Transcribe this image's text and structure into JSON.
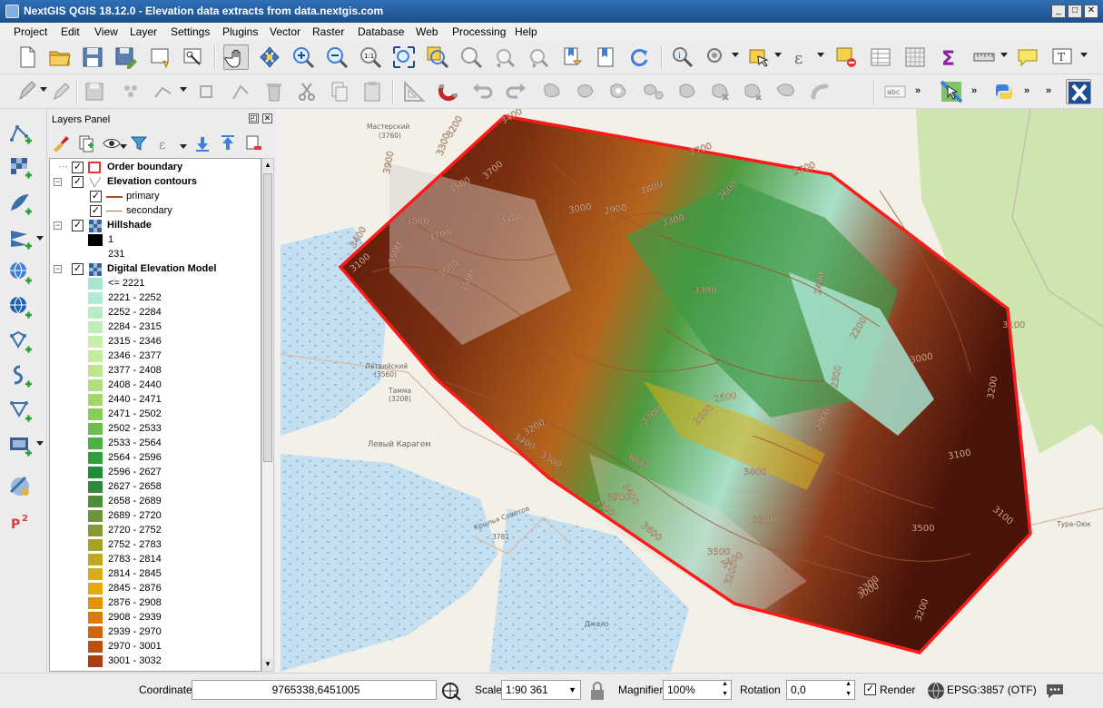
{
  "window": {
    "title": "NextGIS QGIS 18.12.0 - Elevation data extracts from data.nextgis.com",
    "minimize": "_",
    "maximize": "□",
    "close": "✕"
  },
  "menu": [
    "Project",
    "Edit",
    "View",
    "Layer",
    "Settings",
    "Plugins",
    "Vector",
    "Raster",
    "Database",
    "Web",
    "Processing",
    "Help"
  ],
  "layers_panel": {
    "title": "Layers Panel",
    "layers": [
      {
        "name": "Order boundary",
        "checked": true,
        "bold": true
      },
      {
        "name": "Elevation contours",
        "checked": true,
        "bold": true,
        "children": [
          "primary",
          "secondary"
        ]
      },
      {
        "name": "Hillshade",
        "checked": true,
        "bold": true,
        "legend": [
          "1",
          "231"
        ]
      },
      {
        "name": "Digital Elevation Model",
        "checked": true,
        "bold": true
      }
    ],
    "dem_legend": [
      {
        "label": "<= 2221",
        "color": "#a8e6d4"
      },
      {
        "label": "2221 - 2252",
        "color": "#b2ead2"
      },
      {
        "label": "2252 - 2284",
        "color": "#b9ecc5"
      },
      {
        "label": "2284 - 2315",
        "color": "#c0eeb8"
      },
      {
        "label": "2315 - 2346",
        "color": "#c6efa9"
      },
      {
        "label": "2346 - 2377",
        "color": "#c4ec9a"
      },
      {
        "label": "2377 - 2408",
        "color": "#bde68b"
      },
      {
        "label": "2408 - 2440",
        "color": "#b3df7b"
      },
      {
        "label": "2440 - 2471",
        "color": "#a4d76a"
      },
      {
        "label": "2471 - 2502",
        "color": "#8ccd5a"
      },
      {
        "label": "2502 - 2533",
        "color": "#6bbf4c"
      },
      {
        "label": "2533 - 2564",
        "color": "#4cb143"
      },
      {
        "label": "2564 - 2596",
        "color": "#2f9f3c"
      },
      {
        "label": "2596 - 2627",
        "color": "#1f8c38"
      },
      {
        "label": "2627 - 2658",
        "color": "#2e8a3a"
      },
      {
        "label": "2658 - 2689",
        "color": "#4a8d3a"
      },
      {
        "label": "2689 - 2720",
        "color": "#6a9436"
      },
      {
        "label": "2720 - 2752",
        "color": "#8a9a30"
      },
      {
        "label": "2752 - 2783",
        "color": "#a6a228"
      },
      {
        "label": "2783 - 2814",
        "color": "#c0a81e"
      },
      {
        "label": "2814 - 2845",
        "color": "#d8ad12"
      },
      {
        "label": "2845 - 2876",
        "color": "#e8a808"
      },
      {
        "label": "2876 - 2908",
        "color": "#e69104"
      },
      {
        "label": "2908 - 2939",
        "color": "#dd7a05"
      },
      {
        "label": "2939 - 2970",
        "color": "#cf6408"
      },
      {
        "label": "2970 - 3001",
        "color": "#bf500b"
      },
      {
        "label": "3001 - 3032",
        "color": "#ab3e0d"
      }
    ]
  },
  "map": {
    "contour_labels": [
      "3400",
      "3200",
      "3900",
      "3700",
      "3300",
      "3500",
      "2700",
      "2700",
      "2600",
      "2800",
      "2900",
      "3000",
      "3400",
      "3300",
      "3800",
      "3700",
      "3400",
      "3100",
      "3500",
      "3600",
      "3500",
      "2400",
      "3300",
      "2300",
      "2200",
      "2300",
      "3100",
      "3000",
      "3200",
      "2500",
      "2600",
      "2700",
      "3400",
      "3200",
      "3300",
      "3000",
      "3100",
      "3400",
      "3100",
      "3500",
      "3300",
      "3300",
      "3400",
      "3500",
      "3600",
      "3500",
      "3400",
      "3200",
      "3300",
      "3200",
      "3000"
    ],
    "place_labels": [
      "Мастерский",
      "(3760)",
      "Латвийский",
      "(3560)",
      "Тамма",
      "(3208)",
      "Левый Карагем",
      "Крылья Советов",
      "3781",
      "Джело",
      "Тура-Оюк"
    ],
    "colors": {
      "boundary": "#ff1a1a",
      "water": "#c4dff0",
      "forest": "#cfe5b0",
      "contour": "#a0522d"
    }
  },
  "status": {
    "coordinate_label": "Coordinate",
    "coordinate_value": "9765338,6451005",
    "scale_label": "Scale",
    "scale_value": "1:90 361",
    "magnifier_label": "Magnifier",
    "magnifier_value": "100%",
    "rotation_label": "Rotation",
    "rotation_value": "0,0",
    "render_label": "Render",
    "crs": "EPSG:3857 (OTF)"
  }
}
